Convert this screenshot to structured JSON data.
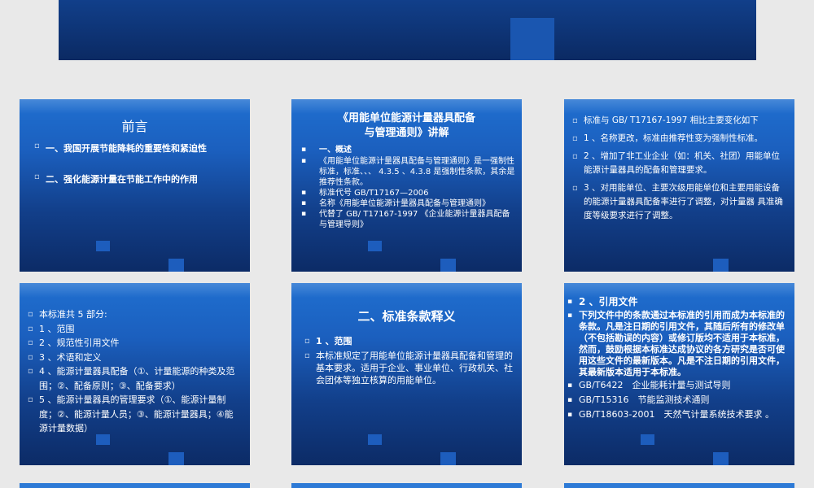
{
  "slide2": {
    "title": "前言",
    "items": [
      "一、我国开展节能降耗的重要性和紧迫性",
      "二、强化能源计量在节能工作中的作用"
    ]
  },
  "slide3": {
    "title_line1": "《用能单位能源计量器具配备",
    "title_line2": "与管理通则》讲解",
    "items": [
      "一、概述",
      "《用能单位能源计量器具配备与管理通则》是一强制性标准，标准、、、 4.3.5 、4.3.8 是强制性条款，其余是推荐性条款。",
      "标准代号 GB/T17167—2006",
      "名称《用能单位能源计量器具配备与管理通则》",
      "代替了 GB/ T17167-1997 《企业能源计量器具配备与管理导则》"
    ]
  },
  "slide4": {
    "items": [
      "标准与 GB/ T17167-1997 相比主要变化如下",
      "1 、名称更改，标准由推荐性变为强制性标准。",
      "2 、增加了非工业企业（如：机关、社团）用能单位能源计量器具的配备和管理要求。",
      "3 、对用能单位、主要次级用能单位和主要用能设备的能源计量器具配备率进行了调整，对计量器 具准确度等级要求进行了调整。"
    ]
  },
  "slide5": {
    "items": [
      "本标准共 5 部分:",
      "1 、范围",
      "2 、规范性引用文件",
      "3 、术语和定义",
      "4 、能源计量器具配备（①、计量能源的种类及范围；②、配备原则；③、配备要求）",
      "5 、能源计量器具的管理要求（①、能源计量制度；②、能源计量人员；③、能源计量器具；④能源计量数据）"
    ]
  },
  "slide6": {
    "title": "二、标准条款释义",
    "items": [
      "1 、范围",
      "本标准规定了用能单位能源计量器具配备和管理的基本要求。适用于企业、事业单位、行政机关、社会团体等独立核算的用能单位。"
    ]
  },
  "slide7": {
    "items": [
      "2 、引用文件",
      "下列文件中的条款通过本标准的引用而成为本标准的条款。凡是注日期的引用文件，其随后所有的修改单（不包括勘误的内容）或修订版均不适用于本标准，然而，鼓励根据本标准达成协议的各方研究是否可使用这些文件的最新版本。凡是不注日期的引用文件，其最新版本适用于本标准。",
      "GB/T6422　企业能耗计量与测试导则",
      "GB/T15316　节能监测技术通则",
      "GB/T18603-2001　天然气计量系统技术要求 。"
    ]
  }
}
